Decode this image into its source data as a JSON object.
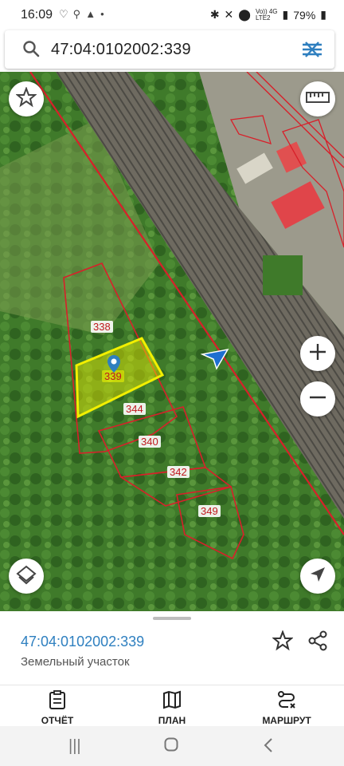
{
  "status": {
    "time": "16:09",
    "battery": "79%",
    "network_top": "Vo)) 4G",
    "network_bottom": "LTE2"
  },
  "search": {
    "query": "47:04:0102002:339"
  },
  "map": {
    "parcel_labels": [
      "338",
      "339",
      "344",
      "340",
      "342",
      "349"
    ],
    "colors": {
      "boundary": "#d8202a",
      "selected": "#f2ef00"
    }
  },
  "sheet": {
    "title": "47:04:0102002:339",
    "subtitle": "Земельный участок"
  },
  "nav": {
    "report": "ОТЧЁТ",
    "plan": "ПЛАН",
    "route": "МАРШРУТ"
  }
}
